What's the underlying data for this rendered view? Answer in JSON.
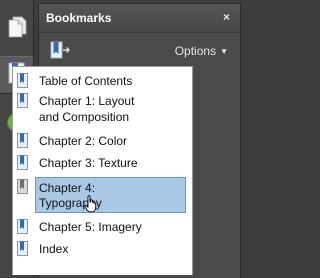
{
  "panel": {
    "title": "Bookmarks",
    "close_label": "×",
    "options_label": "Options"
  },
  "bookmarks": [
    {
      "label_line1": "Table of Contents",
      "label_line2": ""
    },
    {
      "label_line1": "Chapter 1: Layout",
      "label_line2": "and Composition"
    },
    {
      "label_line1": "Chapter 2: Color",
      "label_line2": ""
    },
    {
      "label_line1": "Chapter 3: Texture",
      "label_line2": ""
    },
    {
      "label_line1": "Chapter 4:",
      "label_line2": "Typography",
      "selected": true
    },
    {
      "label_line1": "Chapter 5: Imagery",
      "label_line2": ""
    },
    {
      "label_line1": "Index",
      "label_line2": ""
    }
  ],
  "colors": {
    "selection_fill": "#a9c8e6",
    "selection_border": "#6d96c1",
    "bookmark_icon_blue": "#2f6db3",
    "help_green": "#6cb33e"
  },
  "icons": [
    "pages-icon",
    "bookmarks-icon",
    "help-icon",
    "new-bookmark-icon",
    "bookmark-icon",
    "hand-cursor-icon"
  ]
}
